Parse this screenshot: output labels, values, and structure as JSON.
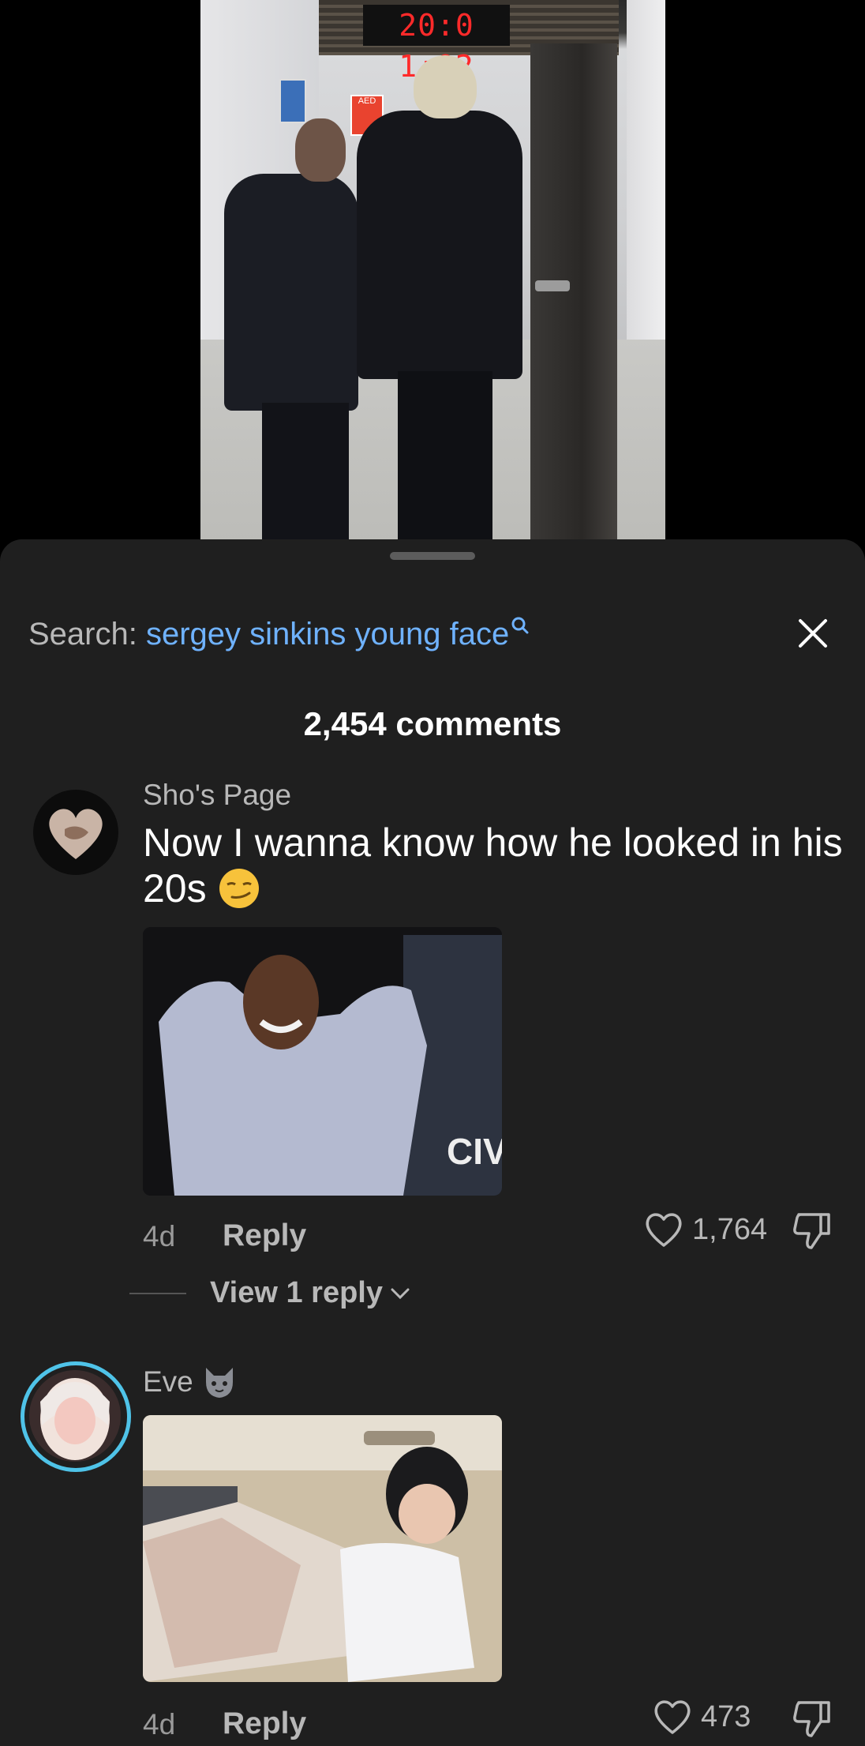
{
  "video": {
    "clock_text": "20:0 1:02",
    "aed_label": "AED"
  },
  "search": {
    "prefix": "Search:",
    "term": "sergey sinkins young face"
  },
  "comments_header": "2,454 comments",
  "comments": [
    {
      "author": "Sho's Page",
      "text": "Now I wanna know how he looked in his 20s",
      "gif_caption": "CIV",
      "age": "4d",
      "reply_label": "Reply",
      "likes": "1,764",
      "view_replies": "View 1 reply"
    },
    {
      "author": "Eve",
      "age": "4d",
      "reply_label": "Reply",
      "likes": "473"
    }
  ],
  "colors": {
    "sheet_bg": "#1f1f1f",
    "search_term": "#6fb2ff",
    "muted_text": "#b8b8b8",
    "avatar_ring": "#4fc3e8"
  },
  "icons": [
    "search-icon",
    "close-icon",
    "heart-icon",
    "thumbs-down-icon",
    "chevron-down-icon",
    "wolf-emoji-icon",
    "smirk-emoji-icon"
  ]
}
